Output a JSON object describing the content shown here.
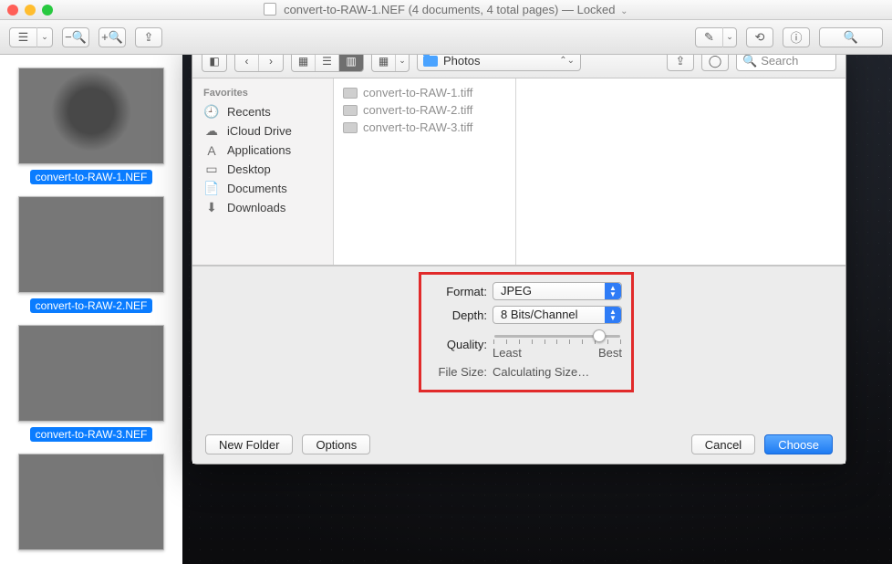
{
  "window": {
    "title": "convert-to-RAW-1.NEF (4 documents, 4 total pages)",
    "locked_label": "— Locked",
    "chevron": "⌄"
  },
  "thumbs": [
    {
      "label": "convert-to-RAW-1.NEF"
    },
    {
      "label": "convert-to-RAW-2.NEF"
    },
    {
      "label": "convert-to-RAW-3.NEF"
    }
  ],
  "sheet": {
    "path_label": "Photos",
    "search_placeholder": "Search",
    "sidebar_header": "Favorites",
    "sidebar": [
      {
        "label": "Recents",
        "icon": "clock-icon"
      },
      {
        "label": "iCloud Drive",
        "icon": "cloud-icon"
      },
      {
        "label": "Applications",
        "icon": "apps-icon"
      },
      {
        "label": "Desktop",
        "icon": "desktop-icon"
      },
      {
        "label": "Documents",
        "icon": "documents-icon"
      },
      {
        "label": "Downloads",
        "icon": "downloads-icon"
      }
    ],
    "files": [
      "convert-to-RAW-1.tiff",
      "convert-to-RAW-2.tiff",
      "convert-to-RAW-3.tiff"
    ],
    "options": {
      "format_label": "Format:",
      "format_value": "JPEG",
      "depth_label": "Depth:",
      "depth_value": "8 Bits/Channel",
      "quality_label": "Quality:",
      "quality_min": "Least",
      "quality_max": "Best",
      "quality_pct": 78,
      "filesize_label": "File Size:",
      "filesize_value": "Calculating Size…"
    },
    "footer": {
      "new_folder": "New Folder",
      "options": "Options",
      "cancel": "Cancel",
      "choose": "Choose"
    }
  },
  "sidebar_glyphs": {
    "clock-icon": "🕘",
    "cloud-icon": "☁︎",
    "apps-icon": "A",
    "desktop-icon": "▭",
    "documents-icon": "📄",
    "downloads-icon": "⬇︎"
  }
}
